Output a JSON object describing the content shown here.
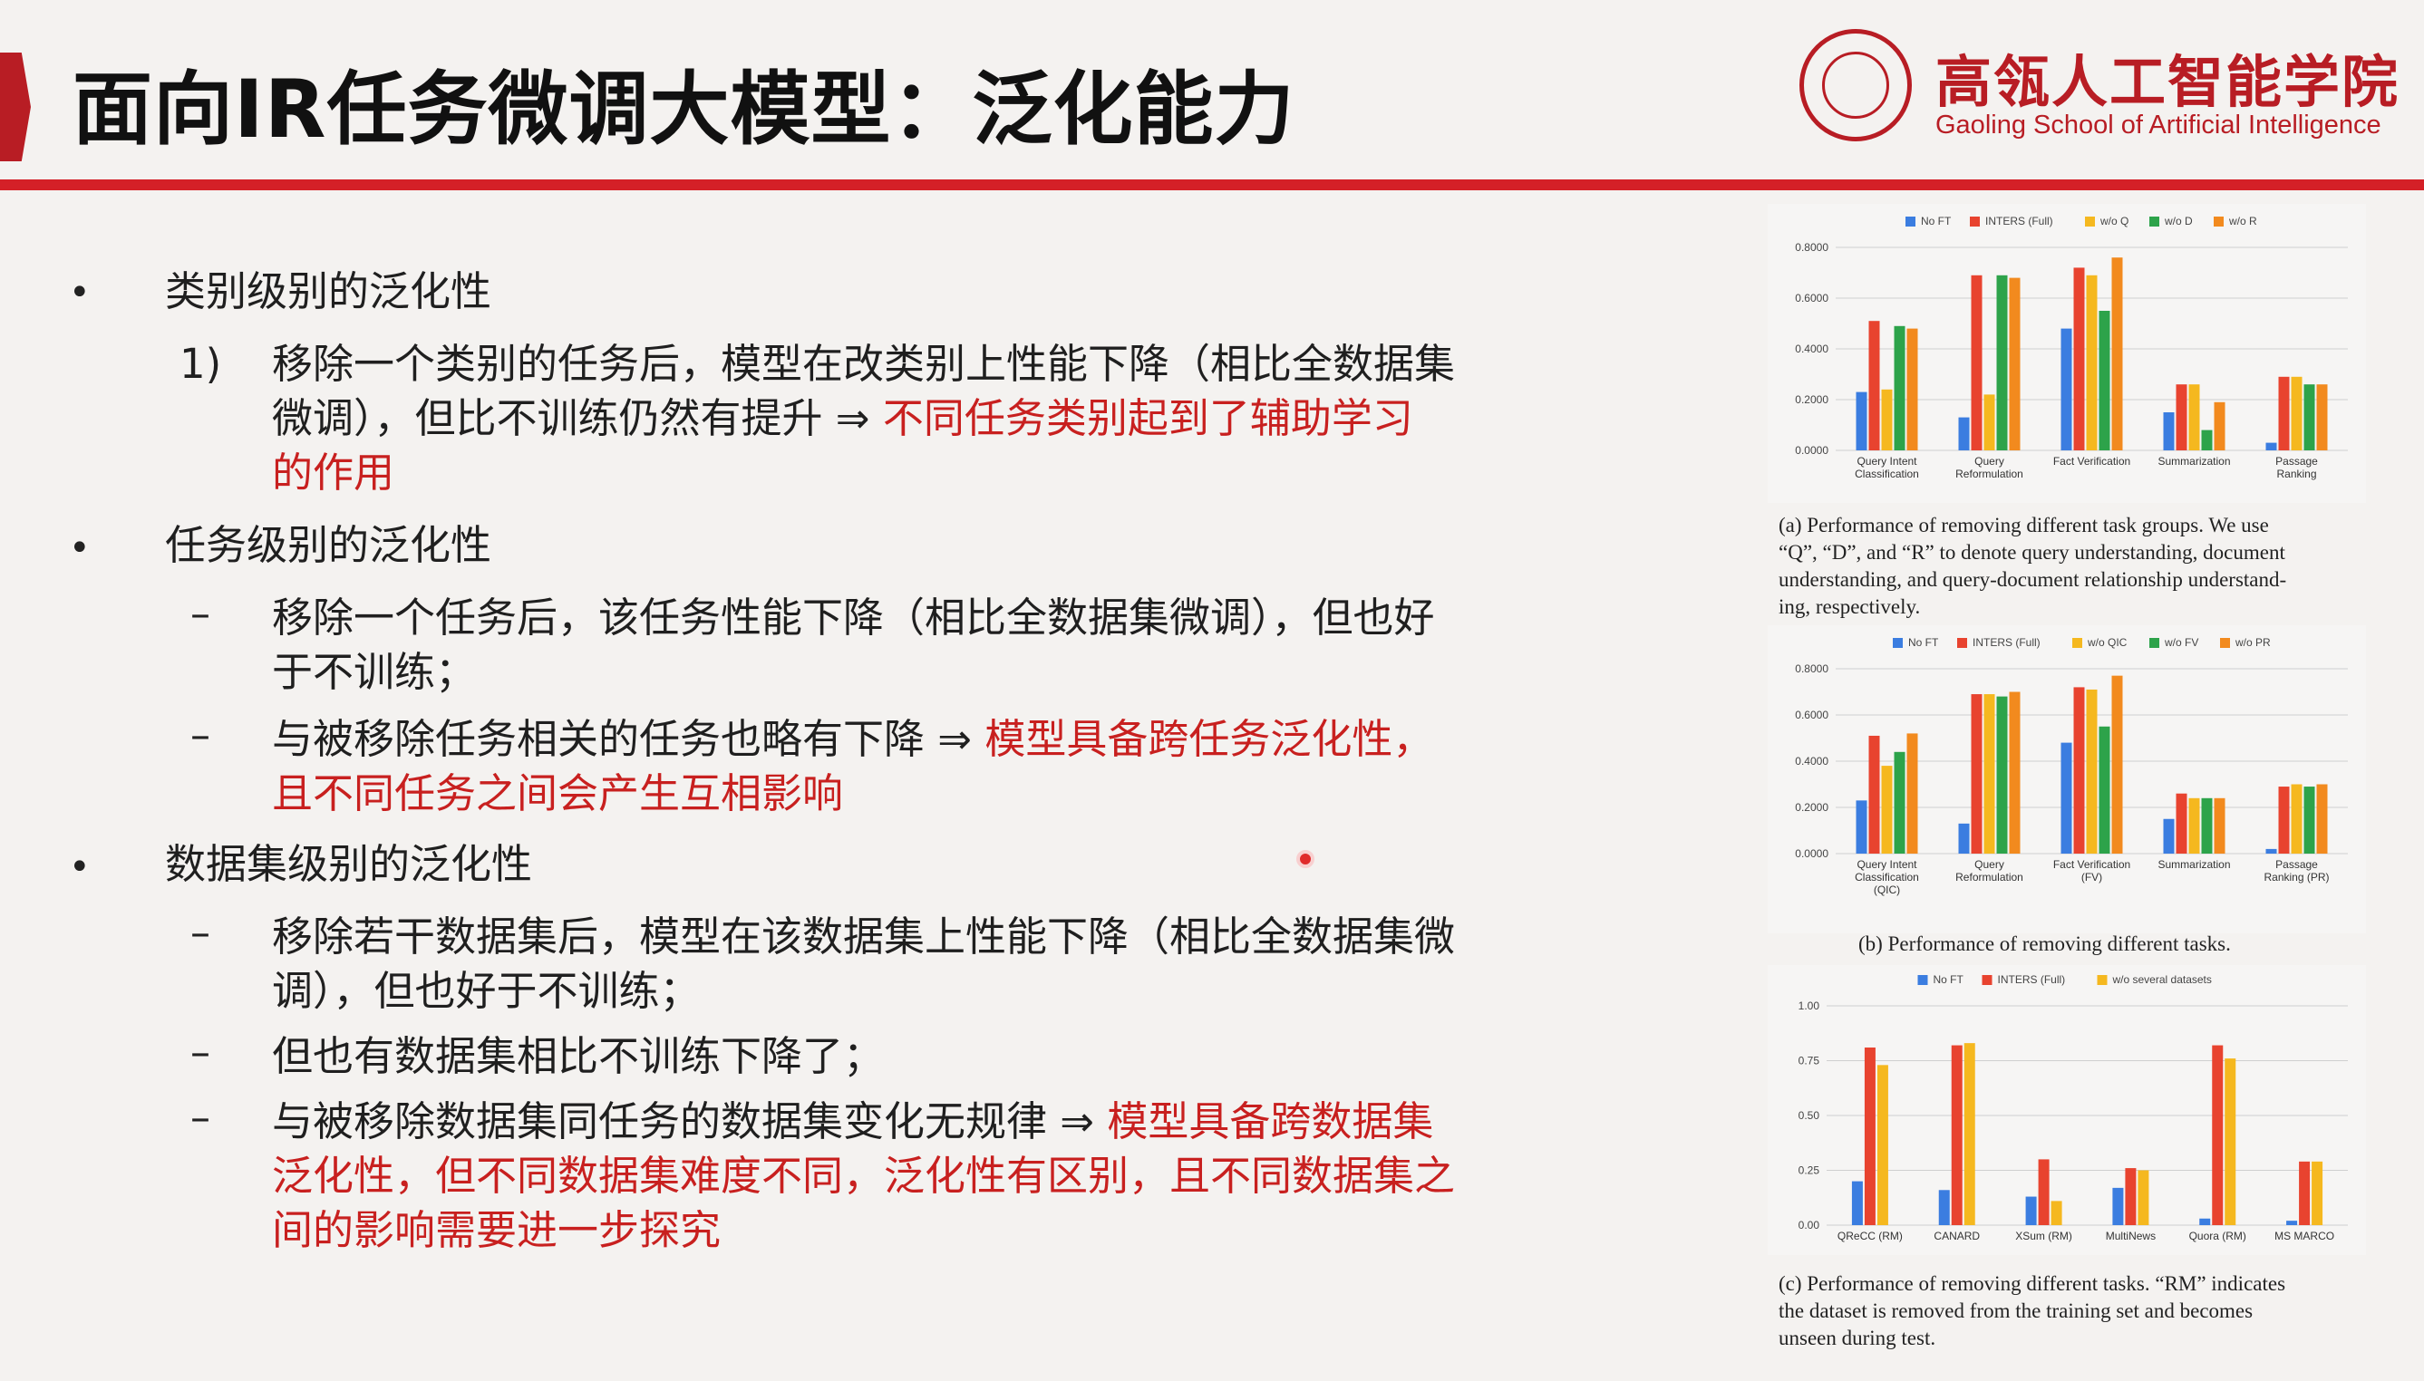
{
  "slide": {
    "title": "面向IR任务微调大模型：泛化能力",
    "school_zh": "高瓴人工智能学院",
    "school_en": "Gaoling School of Artificial Intelligence",
    "colors": {
      "accent_red": "#d42027",
      "text_red": "#c8201f"
    }
  },
  "content": {
    "s1_heading": "类别级别的泛化性",
    "s1_num": "1)",
    "s1_l1": "移除一个类别的任务后，模型在改类别上性能下降（相比全数据集",
    "s1_l2a": "微调），但比不训练仍然有提升 ⇒ ",
    "s1_l2b": "不同任务类别起到了辅助学习",
    "s1_l3": "的作用",
    "s2_heading": "任务级别的泛化性",
    "s2_dash1_l1": "移除一个任务后，该任务性能下降（相比全数据集微调），但也好",
    "s2_dash1_l2": "于不训练；",
    "s2_dash2_l1a": "与被移除任务相关的任务也略有下降 ⇒ ",
    "s2_dash2_l1b": "模型具备跨任务泛化性，",
    "s2_dash2_l2": "且不同任务之间会产生互相影响",
    "s3_heading": "数据集级别的泛化性",
    "s3_dash1_l1": "移除若干数据集后，模型在该数据集上性能下降（相比全数据集微",
    "s3_dash1_l2": "调），但也好于不训练；",
    "s3_dash2": "但也有数据集相比不训练下降了；",
    "s3_dash3_l1a": "与被移除数据集同任务的数据集变化无规律 ⇒ ",
    "s3_dash3_l1b": "模型具备跨数据集",
    "s3_dash3_l2": "泛化性，但不同数据集难度不同，泛化性有区别，且不同数据集之",
    "s3_dash3_l3": "间的影响需要进一步探究",
    "bullet": "•",
    "dash": "–"
  },
  "captions": {
    "a_l1": "(a) Performance of removing different task groups.  We use",
    "a_l2": "“Q”, “D”, and “R” to denote query understanding, document",
    "a_l3": "understanding, and query-document relationship understand-",
    "a_l4": "ing, respectively.",
    "b_l1": "(b) Performance of removing different tasks.",
    "c_l1": "(c) Performance of removing different tasks. “RM” indicates",
    "c_l2": "the dataset is removed from the training set and becomes",
    "c_l3": "unseen during test."
  },
  "chart_data": [
    {
      "type": "bar",
      "categories": [
        [
          "Query Intent",
          "Classification"
        ],
        [
          "Query",
          "Reformulation"
        ],
        [
          "Fact Verification"
        ],
        [
          "Summarization"
        ],
        [
          "Passage",
          "Ranking"
        ]
      ],
      "series": [
        {
          "name": "No FT",
          "color": "#3b7de0",
          "values": [
            0.23,
            0.13,
            0.48,
            0.15,
            0.03
          ]
        },
        {
          "name": "INTERS (Full)",
          "color": "#e8432f",
          "values": [
            0.51,
            0.69,
            0.72,
            0.26,
            0.29
          ]
        },
        {
          "name": "w/o Q",
          "color": "#f5b81f",
          "values": [
            0.24,
            0.22,
            0.69,
            0.26,
            0.29
          ]
        },
        {
          "name": "w/o D",
          "color": "#2da34a",
          "values": [
            0.49,
            0.69,
            0.55,
            0.08,
            0.26
          ]
        },
        {
          "name": "w/o R",
          "color": "#f28a1e",
          "values": [
            0.48,
            0.68,
            0.76,
            0.19,
            0.26
          ]
        }
      ],
      "ylim": [
        0,
        0.8
      ],
      "yticks": [
        "0.0000",
        "0.2000",
        "0.4000",
        "0.6000",
        "0.8000"
      ]
    },
    {
      "type": "bar",
      "categories": [
        [
          "Query Intent",
          "Classification",
          "(QIC)"
        ],
        [
          "Query",
          "Reformulation"
        ],
        [
          "Fact Verification",
          "(FV)"
        ],
        [
          "Summarization"
        ],
        [
          "Passage",
          "Ranking (PR)"
        ]
      ],
      "series": [
        {
          "name": "No FT",
          "color": "#3b7de0",
          "values": [
            0.23,
            0.13,
            0.48,
            0.15,
            0.02
          ]
        },
        {
          "name": "INTERS (Full)",
          "color": "#e8432f",
          "values": [
            0.51,
            0.69,
            0.72,
            0.26,
            0.29
          ]
        },
        {
          "name": "w/o QIC",
          "color": "#f5b81f",
          "values": [
            0.38,
            0.69,
            0.71,
            0.24,
            0.3
          ]
        },
        {
          "name": "w/o FV",
          "color": "#2da34a",
          "values": [
            0.44,
            0.68,
            0.55,
            0.24,
            0.29
          ]
        },
        {
          "name": "w/o PR",
          "color": "#f28a1e",
          "values": [
            0.52,
            0.7,
            0.77,
            0.24,
            0.3
          ]
        }
      ],
      "ylim": [
        0,
        0.8
      ],
      "yticks": [
        "0.0000",
        "0.2000",
        "0.4000",
        "0.6000",
        "0.8000"
      ]
    },
    {
      "type": "bar",
      "categories": [
        [
          "QReCC (RM)"
        ],
        [
          "CANARD"
        ],
        [
          "XSum (RM)"
        ],
        [
          "MultiNews"
        ],
        [
          "Quora (RM)"
        ],
        [
          "MS MARCO"
        ]
      ],
      "series": [
        {
          "name": "No FT",
          "color": "#3b7de0",
          "values": [
            0.2,
            0.16,
            0.13,
            0.17,
            0.03,
            0.02
          ]
        },
        {
          "name": "INTERS (Full)",
          "color": "#e8432f",
          "values": [
            0.81,
            0.82,
            0.3,
            0.26,
            0.82,
            0.29
          ]
        },
        {
          "name": "w/o several datasets",
          "color": "#f5b81f",
          "values": [
            0.73,
            0.83,
            0.11,
            0.25,
            0.76,
            0.29
          ]
        }
      ],
      "ylim": [
        0,
        1
      ],
      "yticks": [
        "0.00",
        "0.25",
        "0.50",
        "0.75",
        "1.00"
      ]
    }
  ]
}
